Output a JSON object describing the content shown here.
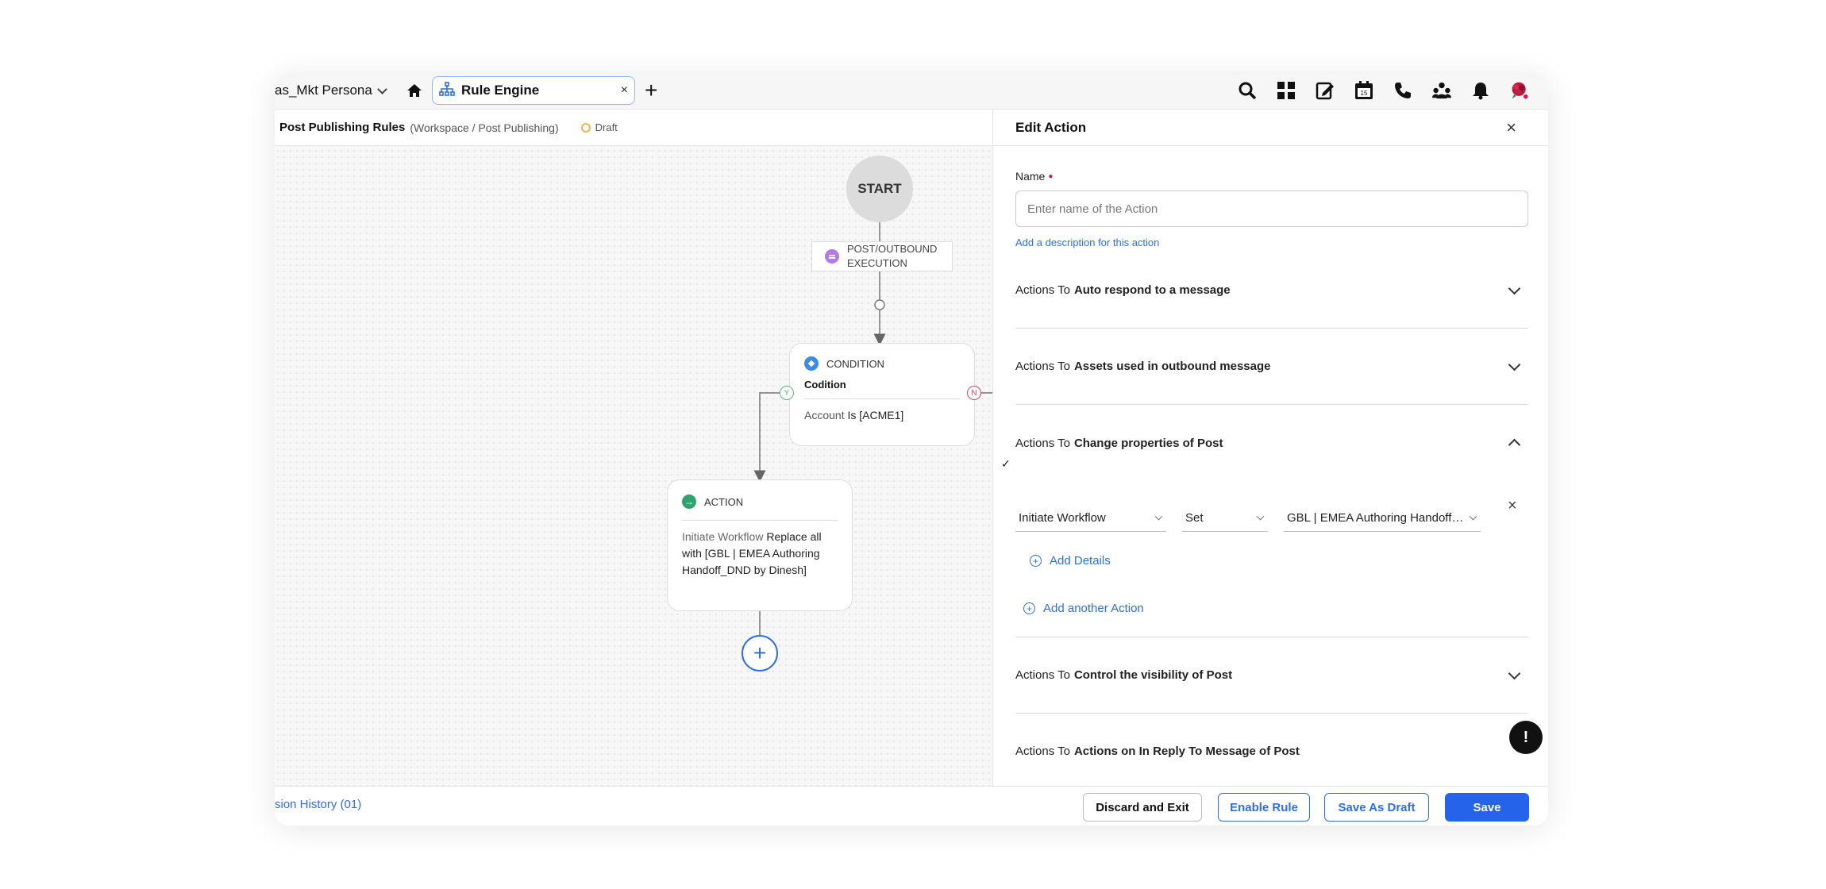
{
  "topbar": {
    "persona": "as_Mkt Persona",
    "tab_label": "Rule Engine",
    "tab_close": "×",
    "add_tab": "+",
    "icons": [
      "search-icon",
      "apps-grid-icon",
      "compose-icon",
      "calendar-icon",
      "phone-icon",
      "community-icon",
      "bell-icon",
      "avatar"
    ],
    "calendar_day": "15"
  },
  "subheader": {
    "title": "Post Publishing Rules",
    "path": "(Workspace / Post Publishing)",
    "status": "Draft"
  },
  "flow": {
    "start": "START",
    "trigger_line1": "POST/OUTBOUND",
    "trigger_line2": "EXECUTION",
    "condition_type": "CONDITION",
    "condition_name": "Codition",
    "condition_field": "Account",
    "condition_rule": "Is [ACME1]",
    "branch_yes": "Y",
    "branch_no": "N",
    "action_type": "ACTION",
    "action_key": "Initiate Workflow",
    "action_value": "Replace all with [GBL | EMEA Authoring Handoff_DND by Dinesh]",
    "add_node": "+"
  },
  "panel": {
    "title": "Edit Action",
    "close": "×",
    "name_label": "Name",
    "name_placeholder": "Enter name of the Action",
    "desc_link": "Add a description for this action",
    "prefix": "Actions To",
    "sections": [
      {
        "label": "Auto respond to a message",
        "expanded": false
      },
      {
        "label": "Assets used in outbound message",
        "expanded": false
      },
      {
        "label": "Change properties of Post",
        "expanded": true,
        "checked": true
      },
      {
        "label": "Control the visibility of Post",
        "expanded": false
      },
      {
        "label": "Actions on In Reply To Message of Post",
        "expanded": false
      }
    ],
    "check": "✓",
    "row": {
      "field": "Initiate Workflow",
      "operator": "Set",
      "value": "GBL | EMEA Authoring Handoff_DND by Dinesh",
      "remove": "×"
    },
    "add_details": "Add Details",
    "add_another": "Add another Action",
    "alert": "!"
  },
  "footer": {
    "version_history": "sion History (01)",
    "discard": "Discard and Exit",
    "enable": "Enable Rule",
    "save_draft": "Save As Draft",
    "save": "Save"
  },
  "colors": {
    "accent": "#2563eb",
    "link": "#2e6fe0",
    "draft": "#e8b84a",
    "yes": "#5fb87a",
    "no": "#d34a5b"
  }
}
